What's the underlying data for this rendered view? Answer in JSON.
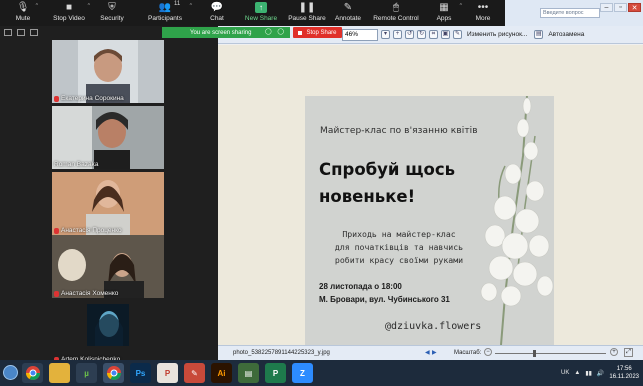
{
  "toolbar": {
    "mute": "Mute",
    "stop_video": "Stop Video",
    "security": "Security",
    "participants": "Participants",
    "participants_count": "11",
    "chat": "Chat",
    "new_share": "New Share",
    "pause_share": "Pause Share",
    "annotate": "Annotate",
    "remote_control": "Remote Control",
    "apps": "Apps",
    "more": "More"
  },
  "share_banner": {
    "text": "You are screen sharing",
    "stop": "Stop Share"
  },
  "participants": [
    {
      "name": "Екатерина Сорокина",
      "muted": true,
      "active": false
    },
    {
      "name": "Roman Bazaka",
      "muted": false,
      "active": true
    },
    {
      "name": "Анастасія Проценко",
      "muted": true,
      "active": false
    },
    {
      "name": "Анастасія Хоменко",
      "muted": true,
      "active": false
    },
    {
      "name": "Artem Kolisnichenko",
      "muted": true,
      "active": false
    }
  ],
  "viewer": {
    "help_placeholder": "Введите вопрос",
    "zoom": "46%",
    "edit_picture": "Изменить рисунок...",
    "autocorrect": "Автозамена",
    "filename": "photo_5382257891144225323_y.jpg",
    "zoom_label": "Масштаб:"
  },
  "poster": {
    "subtitle": "Майстер-клас по в'язанню квітів",
    "headline_1": "Спробуй щось",
    "headline_2": "новеньке!",
    "body_1": "Приходь на майстер-клас",
    "body_2": "для початківців та навчись",
    "body_3": "робити красу своїми руками",
    "date": "28 листопада о 18:00",
    "address": "М. Бровари, вул. Чубинського 31",
    "handle": "@dziuvka.flowers"
  },
  "taskbar": {
    "apps": [
      "chrome",
      "file-explorer",
      "utorrent",
      "chrome",
      "photoshop",
      "pdf-reader",
      "paint",
      "illustrator",
      "media-app",
      "publisher",
      "zoom"
    ],
    "lang": "UK",
    "time": "17:56",
    "date": "16.11.2023"
  },
  "colors": {
    "zoom_bg": "#1a1a1a",
    "share_green": "#2fa34a",
    "stop_red": "#e0302a",
    "active_speaker": "#e3e33e",
    "poster_bg": "#d1d3d0"
  }
}
